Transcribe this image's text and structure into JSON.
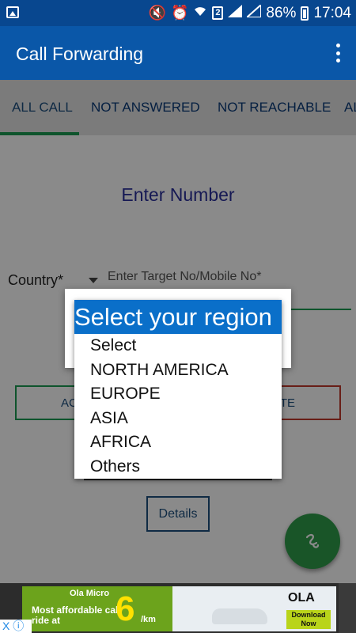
{
  "status_bar": {
    "battery_percent": "86%",
    "time": "17:04",
    "sim_slot": "2",
    "network": "R"
  },
  "app_bar": {
    "title": "Call Forwarding",
    "menu_icon": "more-vert-icon"
  },
  "tabs": [
    {
      "label": "ALL CALL",
      "active": true
    },
    {
      "label": "NOT ANSWERED",
      "active": false
    },
    {
      "label": "NOT REACHABLE",
      "active": false
    },
    {
      "label": "AL",
      "active": false
    }
  ],
  "main": {
    "heading": "Enter Number",
    "country_label": "Country*",
    "target_placeholder": "Enter Target No/Mobile No*",
    "left_button": "AC",
    "right_button": "TE",
    "details_button": "Details"
  },
  "dialog": {
    "title": "Select your region",
    "options": [
      "Select",
      "NORTH AMERICA",
      "EUROPE",
      "ASIA",
      "AFRICA",
      "Others"
    ]
  },
  "ad": {
    "brand_line": "Ola Micro",
    "tagline": "Most affordable cab ride at",
    "price": "6",
    "unit": "/km",
    "logo": "OLA",
    "cta": "Download Now",
    "close_label": "X"
  },
  "colors": {
    "app_bar": "#0a57a8",
    "accent_green": "#1a9c52",
    "dialog_header": "#0a6fc9"
  }
}
